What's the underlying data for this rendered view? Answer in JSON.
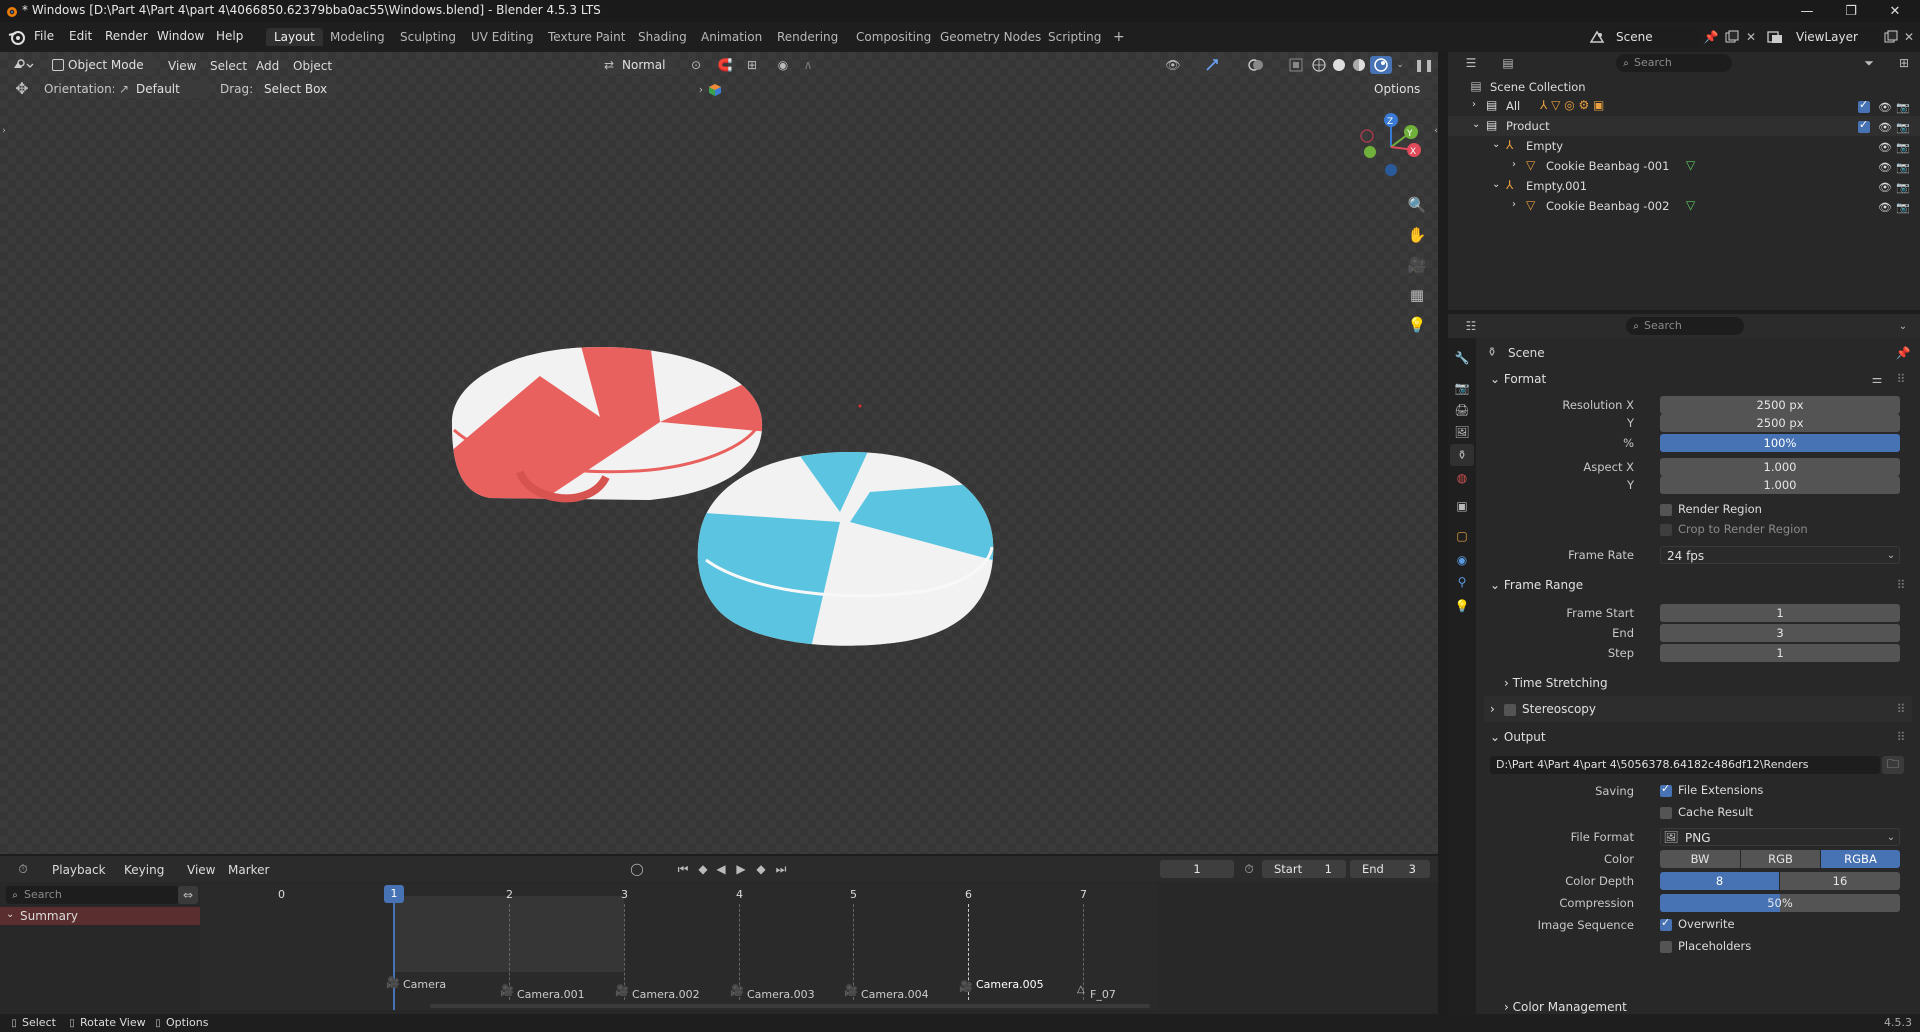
{
  "titlebar": {
    "title": "* Windows [D:\\Part 4\\Part 4\\part 4\\4066850.62379bba0ac55\\Windows.blend] - Blender 4.5.3 LTS",
    "minimize": "—",
    "maximize": "❐",
    "close": "✕"
  },
  "menubar": {
    "menus": [
      "File",
      "Edit",
      "Render",
      "Window",
      "Help"
    ],
    "workspaces": [
      "Layout",
      "Modeling",
      "Sculpting",
      "UV Editing",
      "Texture Paint",
      "Shading",
      "Animation",
      "Rendering",
      "Compositing",
      "Geometry Nodes",
      "Scripting"
    ],
    "add_workspace": "+",
    "scene_name": "Scene",
    "view_layer": "ViewLayer"
  },
  "viewport": {
    "mode": "Object Mode",
    "menus": [
      "View",
      "Select",
      "Add",
      "Object"
    ],
    "orientation_label": "Orientation:",
    "orientation_value": "Default",
    "drag_label": "Drag:",
    "drag_value": "Select Box",
    "transform_orientation": "Normal",
    "options": "Options",
    "gizmo": {
      "z": "Z",
      "y": "Y",
      "x": "X"
    },
    "colors": {
      "pillow_red": "#e8615e",
      "pillow_blue": "#5bc4e0",
      "pillow_white": "#f2f2f2"
    }
  },
  "timeline": {
    "menus": [
      "Playback",
      "Keying",
      "View",
      "Marker"
    ],
    "current_frame": "1",
    "start_label": "Start",
    "start": "1",
    "end_label": "End",
    "end": "3",
    "search_placeholder": "Search",
    "summary": "Summary",
    "frame_numbers": [
      "0",
      "1",
      "2",
      "3",
      "4",
      "5",
      "6",
      "7"
    ],
    "markers": [
      "Camera",
      "Camera.001",
      "Camera.002",
      "Camera.003",
      "Camera.004",
      "Camera.005",
      "F_07"
    ]
  },
  "statusbar": {
    "select": "Select",
    "rotate": "Rotate View",
    "options": "Options",
    "version": "4.5.3"
  },
  "outliner": {
    "search_placeholder": "Search",
    "scene_collection": "Scene Collection",
    "items": [
      {
        "label": "All"
      },
      {
        "label": "Product"
      },
      {
        "label": "Empty"
      },
      {
        "label": "Cookie Beanbag -001"
      },
      {
        "label": "Empty.001"
      },
      {
        "label": "Cookie Beanbag -002"
      }
    ]
  },
  "properties": {
    "search_placeholder": "Search",
    "context": "Scene",
    "format": {
      "title": "Format",
      "resolution_x_label": "Resolution X",
      "resolution_x": "2500 px",
      "y_label": "Y",
      "resolution_y": "2500 px",
      "percent_label": "%",
      "percent": "100%",
      "aspect_x_label": "Aspect X",
      "aspect_x": "1.000",
      "aspect_y_label": "Y",
      "aspect_y": "1.000",
      "render_region": "Render Region",
      "crop_region": "Crop to Render Region",
      "frame_rate_label": "Frame Rate",
      "frame_rate": "24 fps"
    },
    "frame_range": {
      "title": "Frame Range",
      "start_label": "Frame Start",
      "start": "1",
      "end_label": "End",
      "end": "3",
      "step_label": "Step",
      "step": "1"
    },
    "time_stretching": "Time Stretching",
    "stereoscopy": "Stereoscopy",
    "output": {
      "title": "Output",
      "path": "D:\\Part 4\\Part 4\\part 4\\5056378.64182c486df12\\Renders",
      "saving_label": "Saving",
      "file_extensions": "File Extensions",
      "cache_result": "Cache Result",
      "file_format_label": "File Format",
      "file_format": "PNG",
      "color_label": "Color",
      "color_bw": "BW",
      "color_rgb": "RGB",
      "color_rgba": "RGBA",
      "depth_label": "Color Depth",
      "depth_8": "8",
      "depth_16": "16",
      "compression_label": "Compression",
      "compression": "50%",
      "image_sequence_label": "Image Sequence",
      "overwrite": "Overwrite",
      "placeholders": "Placeholders"
    },
    "color_management": "Color Management"
  }
}
